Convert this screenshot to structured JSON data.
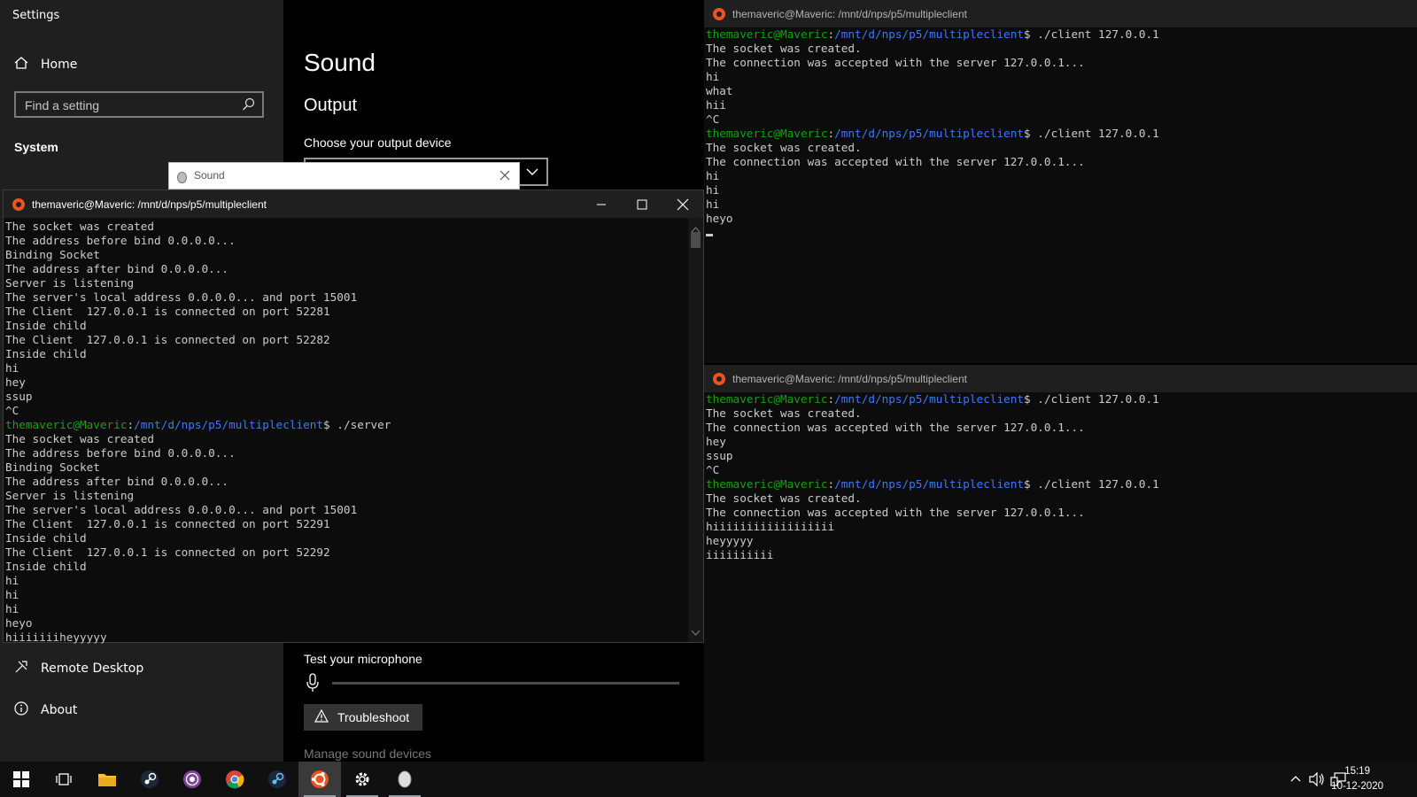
{
  "settings": {
    "window_title": "Settings",
    "nav_home": "Home",
    "search_placeholder": "Find a setting",
    "section": "System",
    "nav_remote": "Remote Desktop",
    "nav_about": "About",
    "page_title": "Sound",
    "output_heading": "Output",
    "choose_device_label": "Choose your output device",
    "mic_test_label": "Test your microphone",
    "mic_level": 0,
    "troubleshoot_label": "Troubleshoot",
    "manage_link": "Manage sound devices"
  },
  "sound_dialog": {
    "title": "Sound"
  },
  "server_terminal": {
    "title": "themaveric@Maveric: /mnt/d/nps/p5/multipleclient",
    "lines": [
      {
        "text": "The socket was created"
      },
      {
        "text": "The address before bind 0.0.0.0..."
      },
      {
        "text": "Binding Socket"
      },
      {
        "text": "The address after bind 0.0.0.0..."
      },
      {
        "text": "Server is listening"
      },
      {
        "text": "The server's local address 0.0.0.0... and port 15001"
      },
      {
        "text": "The Client  127.0.0.1 is connected on port 52281"
      },
      {
        "text": "Inside child"
      },
      {
        "text": "The Client  127.0.0.1 is connected on port 52282"
      },
      {
        "text": "Inside child"
      },
      {
        "text": "hi"
      },
      {
        "text": "hey"
      },
      {
        "text": "ssup"
      },
      {
        "text": "^C"
      },
      {
        "prompt_user": "themaveric@Maveric",
        "prompt_path": "/mnt/d/nps/p5/multipleclient",
        "cmd": "$ ./server"
      },
      {
        "text": "The socket was created"
      },
      {
        "text": "The address before bind 0.0.0.0..."
      },
      {
        "text": "Binding Socket"
      },
      {
        "text": "The address after bind 0.0.0.0..."
      },
      {
        "text": "Server is listening"
      },
      {
        "text": "The server's local address 0.0.0.0... and port 15001"
      },
      {
        "text": "The Client  127.0.0.1 is connected on port 52291"
      },
      {
        "text": "Inside child"
      },
      {
        "text": "The Client  127.0.0.1 is connected on port 52292"
      },
      {
        "text": "Inside child"
      },
      {
        "text": "hi"
      },
      {
        "text": "hi"
      },
      {
        "text": "hi"
      },
      {
        "text": "heyo"
      },
      {
        "text": "hiiiiiiiheyyyyy"
      }
    ]
  },
  "client_terminal_top": {
    "title": "themaveric@Maveric: /mnt/d/nps/p5/multipleclient",
    "lines": [
      {
        "prompt_user": "themaveric@Maveric",
        "prompt_path": "/mnt/d/nps/p5/multipleclient",
        "cmd": "$ ./client 127.0.0.1"
      },
      {
        "text": "The socket was created."
      },
      {
        "text": "The connection was accepted with the server 127.0.0.1..."
      },
      {
        "text": "hi"
      },
      {
        "text": "what"
      },
      {
        "text": "hii"
      },
      {
        "text": "^C"
      },
      {
        "prompt_user": "themaveric@Maveric",
        "prompt_path": "/mnt/d/nps/p5/multipleclient",
        "cmd": "$ ./client 127.0.0.1"
      },
      {
        "text": "The socket was created."
      },
      {
        "text": "The connection was accepted with the server 127.0.0.1..."
      },
      {
        "text": "hi"
      },
      {
        "text": "hi"
      },
      {
        "text": "hi"
      },
      {
        "text": "heyo"
      }
    ]
  },
  "client_terminal_bottom": {
    "title": "themaveric@Maveric: /mnt/d/nps/p5/multipleclient",
    "lines": [
      {
        "prompt_user": "themaveric@Maveric",
        "prompt_path": "/mnt/d/nps/p5/multipleclient",
        "cmd": "$ ./client 127.0.0.1"
      },
      {
        "text": "The socket was created."
      },
      {
        "text": "The connection was accepted with the server 127.0.0.1..."
      },
      {
        "text": "hey"
      },
      {
        "text": "ssup"
      },
      {
        "text": "^C"
      },
      {
        "prompt_user": "themaveric@Maveric",
        "prompt_path": "/mnt/d/nps/p5/multipleclient",
        "cmd": "$ ./client 127.0.0.1"
      },
      {
        "text": "The socket was created."
      },
      {
        "text": "The connection was accepted with the server 127.0.0.1..."
      },
      {
        "text": "hiiiiiiiiiiiiiiiiii"
      },
      {
        "text": "heyyyyy"
      },
      {
        "text": "iiiiiiiiii"
      }
    ]
  },
  "taskbar": {
    "apps": [
      "start-icon",
      "task-view-icon",
      "file-explorer-icon",
      "steam-icon",
      "tor-browser-icon",
      "chrome-icon",
      "steam-icon",
      "ubuntu-terminal-icon",
      "settings-gear-icon",
      "sound-app-icon"
    ],
    "time": "15:19",
    "date": "10-12-2020"
  },
  "colors": {
    "prompt_user": "#13a10e",
    "prompt_path": "#3b78ff",
    "ubuntu_orange": "#e95420"
  }
}
